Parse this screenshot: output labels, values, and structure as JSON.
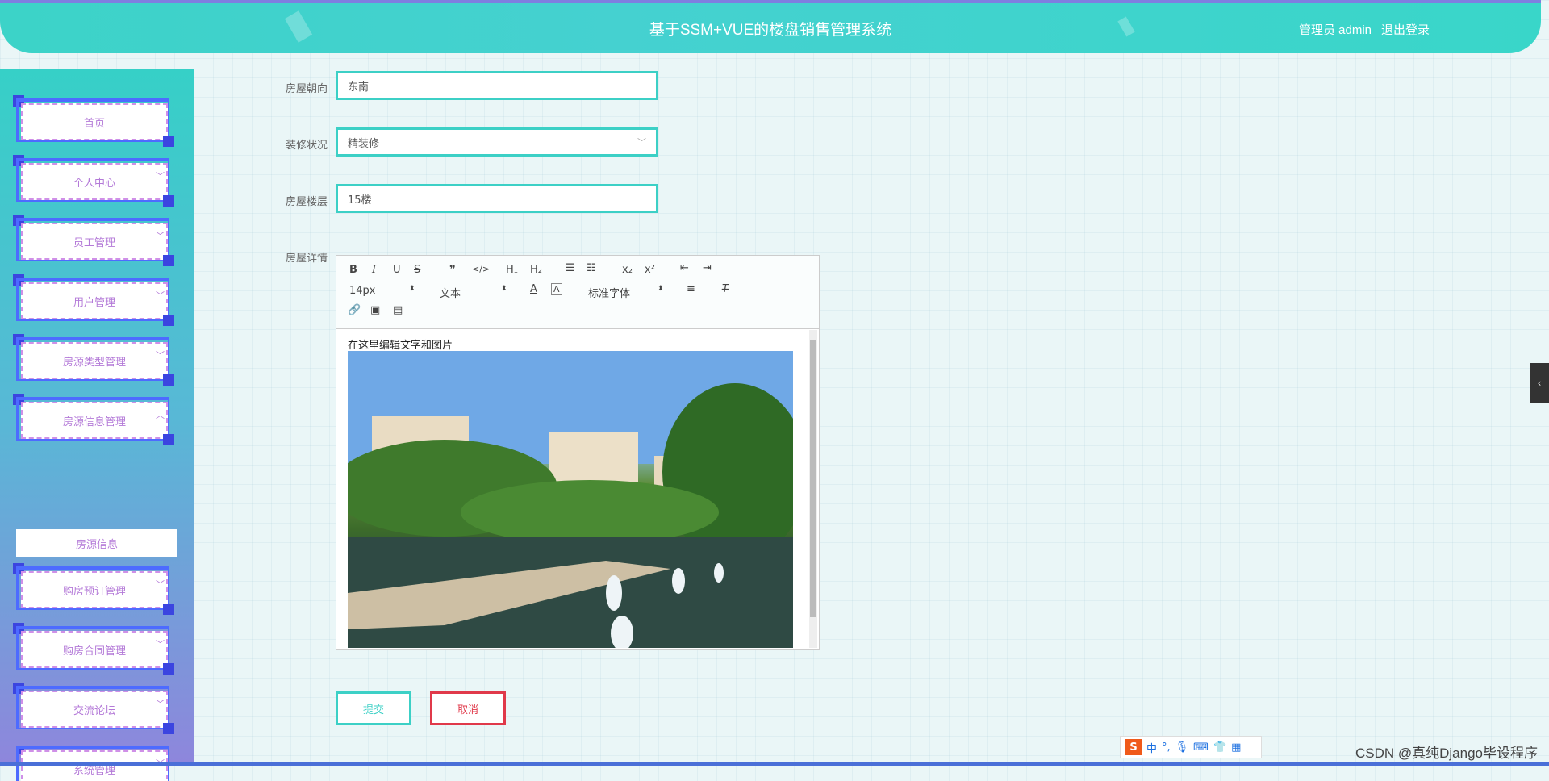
{
  "header": {
    "title": "基于SSM+VUE的楼盘销售管理系统",
    "user": "管理员 admin",
    "logout": "退出登录"
  },
  "sidebar": {
    "items": [
      {
        "label": "首页"
      },
      {
        "label": "个人中心"
      },
      {
        "label": "员工管理"
      },
      {
        "label": "用户管理"
      },
      {
        "label": "房源类型管理"
      },
      {
        "label": "房源信息管理"
      },
      {
        "label": "购房预订管理"
      },
      {
        "label": "购房合同管理"
      },
      {
        "label": "交流论坛"
      },
      {
        "label": "系统管理"
      }
    ],
    "sub_item": "房源信息"
  },
  "form": {
    "orientation": {
      "label": "房屋朝向",
      "value": "东南"
    },
    "decoration": {
      "label": "装修状况",
      "value": "精装修"
    },
    "floor": {
      "label": "房屋楼层",
      "value": "15楼"
    },
    "details": {
      "label": "房屋详情",
      "text": "在这里编辑文字和图片"
    }
  },
  "editor": {
    "font_size": "14px",
    "heading": "文本",
    "font_family": "标准字体"
  },
  "buttons": {
    "submit": "提交",
    "cancel": "取消"
  },
  "watermark": "CSDN @真纯Django毕设程序",
  "ime": {
    "logo": "S",
    "lang": "中"
  }
}
